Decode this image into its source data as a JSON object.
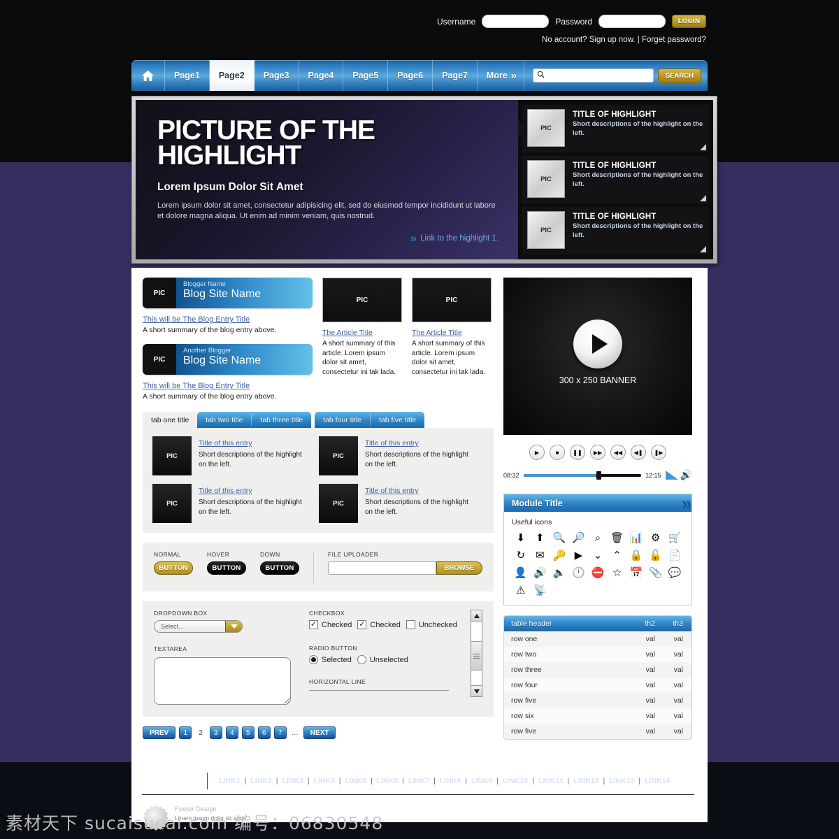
{
  "login": {
    "username_label": "Username",
    "password_label": "Password",
    "username_value": "",
    "password_value": "",
    "login_button": "LOGIN",
    "sub_text": "No account? Sign up now. | Forget password?"
  },
  "nav": {
    "home_icon": "home-icon",
    "items": [
      "Page1",
      "Page2",
      "Page3",
      "Page4",
      "Page5",
      "Page6",
      "Page7"
    ],
    "active": "Page2",
    "more_label": "More",
    "more_chevron": "»",
    "search_icon": "search-icon",
    "search_value": "",
    "search_placeholder": "",
    "search_button": "SEARCH"
  },
  "hero": {
    "title_line1": "PICTURE OF THE",
    "title_line2": "HIGHLIGHT",
    "subtitle": "Lorem Ipsum Dolor Sit Amet",
    "body": "Lorem ipsum dolor sit amet, consectetur adipisicing elit, sed do eiusmod tempor incididunt ut labore et dolore magna aliqua. Ut enim ad minim veniam, quis nostrud.",
    "link_text": "Link to the highlight 1.",
    "link_chevron": "»",
    "cards": [
      {
        "pic": "PIC",
        "title": "TITLE OF HIGHLIGHT",
        "desc": "Short descriptions of the highlight on the left."
      },
      {
        "pic": "PIC",
        "title": "TITLE OF HIGHLIGHT",
        "desc": "Short descriptions of the highlight on the left."
      },
      {
        "pic": "PIC",
        "title": "TITLE OF HIGHLIGHT",
        "desc": "Short descriptions of the highlight on the left."
      }
    ]
  },
  "blogs": [
    {
      "pic": "PIC",
      "blogger": "Blogger Name",
      "site": "Blog Site Name",
      "entry_title": "This will be The Blog Entry Title",
      "entry_summary": "A short summary of the blog entry above."
    },
    {
      "pic": "PIC",
      "blogger": "Another Blogger",
      "site": "Blog Site Name",
      "entry_title": "This will be The Blog Entry Title",
      "entry_summary": "A short summary of the blog entry above."
    }
  ],
  "articles": [
    {
      "pic": "PIC",
      "title": "The Article Title",
      "summary": "A short summary of this article. Lorem ipsum dolor sit amet, consectetur ini tak lada."
    },
    {
      "pic": "PIC",
      "title": "The Article Title",
      "summary": "A short summary of this article. Lorem ipsum dolor sit amet, consectetur ini tak lada."
    }
  ],
  "tabs": {
    "items": [
      "tab one title",
      "tab two title",
      "tab three title",
      "tab four title",
      "tab five title"
    ],
    "active": "tab one title",
    "entries": [
      {
        "pic": "PIC",
        "title": "Title of this entry",
        "desc": "Short descriptions of the highlight on the left."
      },
      {
        "pic": "PIC",
        "title": "Title of this entry",
        "desc": "Short descriptions of the highlight on the left."
      },
      {
        "pic": "PIC",
        "title": "Title of this entry",
        "desc": "Short descriptions of the highlight on the left."
      },
      {
        "pic": "PIC",
        "title": "Title of this entry",
        "desc": "Short descriptions of the highlight on the left."
      }
    ]
  },
  "buttons_panel": {
    "normal_caption": "NORMAL",
    "hover_caption": "HOVER",
    "down_caption": "DOWN",
    "button_label": "BUTTON",
    "uploader_caption": "FILE UPLOADER",
    "uploader_value": "",
    "browse_label": "BROWSE"
  },
  "form_panel": {
    "dropdown_caption": "DROPDOWN BOX",
    "dropdown_value": "Select...",
    "checkbox_caption": "CHECKBOX",
    "checkboxes": [
      {
        "label": "Checked",
        "checked": true
      },
      {
        "label": "Checked",
        "checked": true
      },
      {
        "label": "Unchecked",
        "checked": false
      }
    ],
    "textarea_caption": "TEXTAREA",
    "textarea_value": "",
    "radio_caption": "RADIO BUTTON",
    "radios": [
      {
        "label": "Selected",
        "selected": true
      },
      {
        "label": "Unselected",
        "selected": false
      }
    ],
    "hr_caption": "HORIZONTAL LINE"
  },
  "pagination": {
    "prev": "PREV",
    "next": "NEXT",
    "pages": [
      "1",
      "2",
      "3",
      "4",
      "5",
      "6",
      "7"
    ],
    "current": "2",
    "ellipsis": "…"
  },
  "media": {
    "banner_label": "300 x 250 BANNER",
    "play_icon": "play-icon",
    "controls": [
      "play-icon",
      "stop-icon",
      "pause-icon",
      "fast-forward-icon",
      "rewind-icon",
      "previous-track-icon",
      "next-track-icon"
    ],
    "time_current": "08:32",
    "time_total": "12:15",
    "volume_icon": "volume-icon"
  },
  "module": {
    "title": "Module Title",
    "chevron": "»",
    "subtitle": "Useful icons",
    "icons": [
      {
        "name": "download-arrow-icon",
        "glyph": "⬇"
      },
      {
        "name": "upload-arrow-icon",
        "glyph": "⬆"
      },
      {
        "name": "zoom-in-icon",
        "glyph": "⌕"
      },
      {
        "name": "zoom-out-icon",
        "glyph": "⌕"
      },
      {
        "name": "search-icon",
        "glyph": "⌕"
      },
      {
        "name": "trash-icon",
        "glyph": "Ὕ1"
      },
      {
        "name": "bar-chart-icon",
        "glyph": "█"
      },
      {
        "name": "gear-icon",
        "glyph": "⚙"
      },
      {
        "name": "cart-icon",
        "glyph": "⧉"
      },
      {
        "name": "refresh-icon",
        "glyph": "↻"
      },
      {
        "name": "envelope-icon",
        "glyph": "✉"
      },
      {
        "name": "key-icon",
        "glyph": "⚿"
      },
      {
        "name": "play-circle-icon",
        "glyph": "▶"
      },
      {
        "name": "collapse-down-icon",
        "glyph": "⌄"
      },
      {
        "name": "collapse-up-icon",
        "glyph": "⌃"
      },
      {
        "name": "lock-closed-icon",
        "glyph": "ὑ2"
      },
      {
        "name": "lock-open-icon",
        "glyph": "ὑ3"
      },
      {
        "name": "document-icon",
        "glyph": "Ὄ4"
      },
      {
        "name": "user-icon",
        "glyph": "὆4"
      },
      {
        "name": "volume-on-icon",
        "glyph": "ὐa"
      },
      {
        "name": "volume-mute-icon",
        "glyph": "ὐ8"
      },
      {
        "name": "clock-icon",
        "glyph": "◴"
      },
      {
        "name": "block-icon",
        "glyph": "⛔"
      },
      {
        "name": "star-icon",
        "glyph": "☆"
      },
      {
        "name": "calendar-icon",
        "glyph": "Ὄ5"
      },
      {
        "name": "paperclip-icon",
        "glyph": "Ὄe"
      },
      {
        "name": "comment-icon",
        "glyph": "Ὂc"
      },
      {
        "name": "warning-icon",
        "glyph": "⚠"
      },
      {
        "name": "rss-icon",
        "glyph": "὎1"
      }
    ]
  },
  "table": {
    "headers": [
      "table header",
      "th2",
      "th3"
    ],
    "rows": [
      [
        "row one",
        "val",
        "val"
      ],
      [
        "row two",
        "val",
        "val"
      ],
      [
        "row three",
        "val",
        "val"
      ],
      [
        "row four",
        "val",
        "val"
      ],
      [
        "row five",
        "val",
        "val"
      ],
      [
        "row six",
        "val",
        "val"
      ],
      [
        "row five",
        "val",
        "val"
      ]
    ]
  },
  "footer": {
    "brand": "Footer Design",
    "links": [
      "LINK1",
      "LINK2",
      "LINK3",
      "LINK4",
      "LINK5",
      "LINK6",
      "LINK7",
      "LINK8",
      "LINK9",
      "LINK10",
      "LINK11",
      "LINK12",
      "LINK13",
      "LINK14"
    ],
    "separator": "|",
    "caption_title": "Footer Design",
    "caption_sub": "Lorem ipsum dolor sit amet"
  },
  "watermark": {
    "text": "素材天下 sucaisucai.com  编号：06830548"
  },
  "colors": {
    "accent_blue": "#2f86c8",
    "gold": "#b3901f",
    "background_purple": "#362E5E",
    "background_black": "#0b0b0c",
    "link_blue": "#3a5fa8"
  }
}
